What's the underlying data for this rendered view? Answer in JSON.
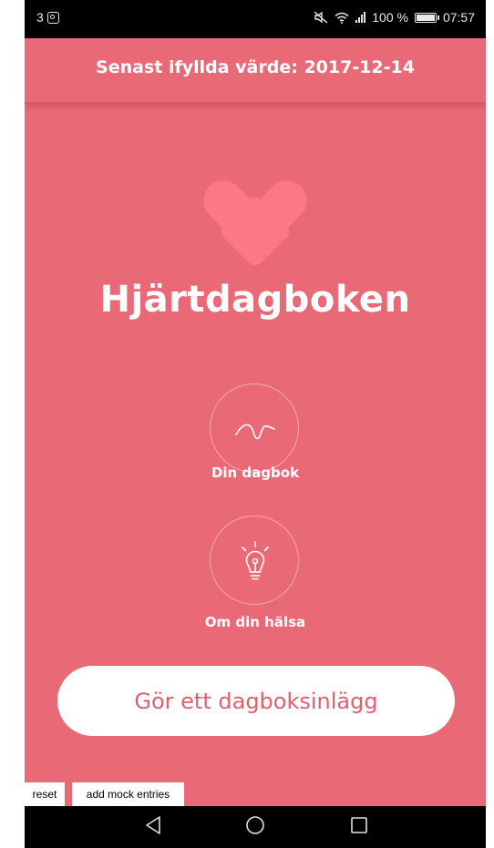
{
  "status_bar": {
    "notification_count": "3",
    "battery_percent": "100 %",
    "time": "07:57",
    "icons": [
      "instagram-icon",
      "mute-icon",
      "wifi-icon",
      "signal-icon",
      "battery-icon"
    ]
  },
  "header": {
    "last_entry": "Senast ifyllda värde: 2017-12-14"
  },
  "app": {
    "title": "Hjärtdagboken",
    "logo_icon": "heart-logo-icon"
  },
  "menu": {
    "diary": {
      "label": "Din dagbok",
      "icon": "heartbeat-line-icon"
    },
    "health": {
      "label": "Om din hälsa",
      "icon": "lightbulb-icon"
    }
  },
  "cta": {
    "label": "Gör ett dagboksinlägg"
  },
  "dev_tools": {
    "reset_label": "reset",
    "mock_label": "add mock entries"
  },
  "nav_bar": {
    "icons": [
      "back-icon",
      "home-icon",
      "recents-icon"
    ]
  },
  "colors": {
    "background": "#e96977",
    "logo": "#fd7885",
    "button_text": "#e15f6f",
    "white": "#ffffff",
    "system_bar": "#000000"
  }
}
